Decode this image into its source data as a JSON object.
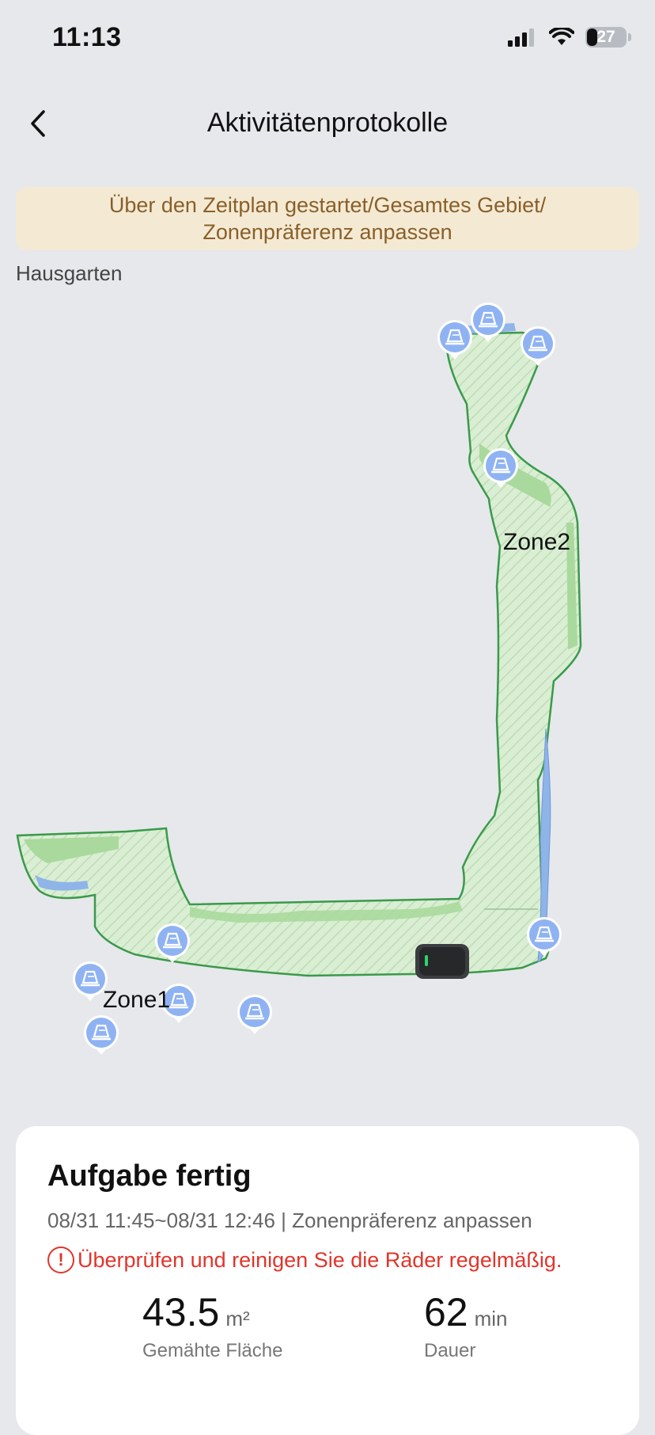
{
  "status": {
    "time": "11:13",
    "battery": "27",
    "battery_level": 0.27
  },
  "header": {
    "title": "Aktivitätenprotokolle",
    "back_icon": "chevron-left-icon"
  },
  "banner": {
    "line1": "Über den Zeitplan gestartet/Gesamtes Gebiet/",
    "line2": "Zonenpräferenz anpassen"
  },
  "map": {
    "garden_name": "Hausgarten",
    "zones": [
      "Zone2",
      "Zone1"
    ]
  },
  "task": {
    "title": "Aufgabe fertig",
    "meta": "08/31 11:45~08/31 12:46 | Zonenpräferenz anpassen",
    "warning": "Überprüfen und reinigen Sie die Räder regelmäßig.",
    "warning_icon": "!",
    "stats": [
      {
        "value": "43.5",
        "unit": "m²",
        "label": "Gemähte Fläche"
      },
      {
        "value": "62",
        "unit": "min",
        "label": "Dauer"
      }
    ]
  },
  "colors": {
    "banner_bg": "#f4ead4",
    "banner_text": "#8a5f29",
    "warning": "#e0352b",
    "lawn": "#cfe9c6",
    "lawn_border": "#3a9a4a",
    "marker": "#8fb3f2"
  }
}
